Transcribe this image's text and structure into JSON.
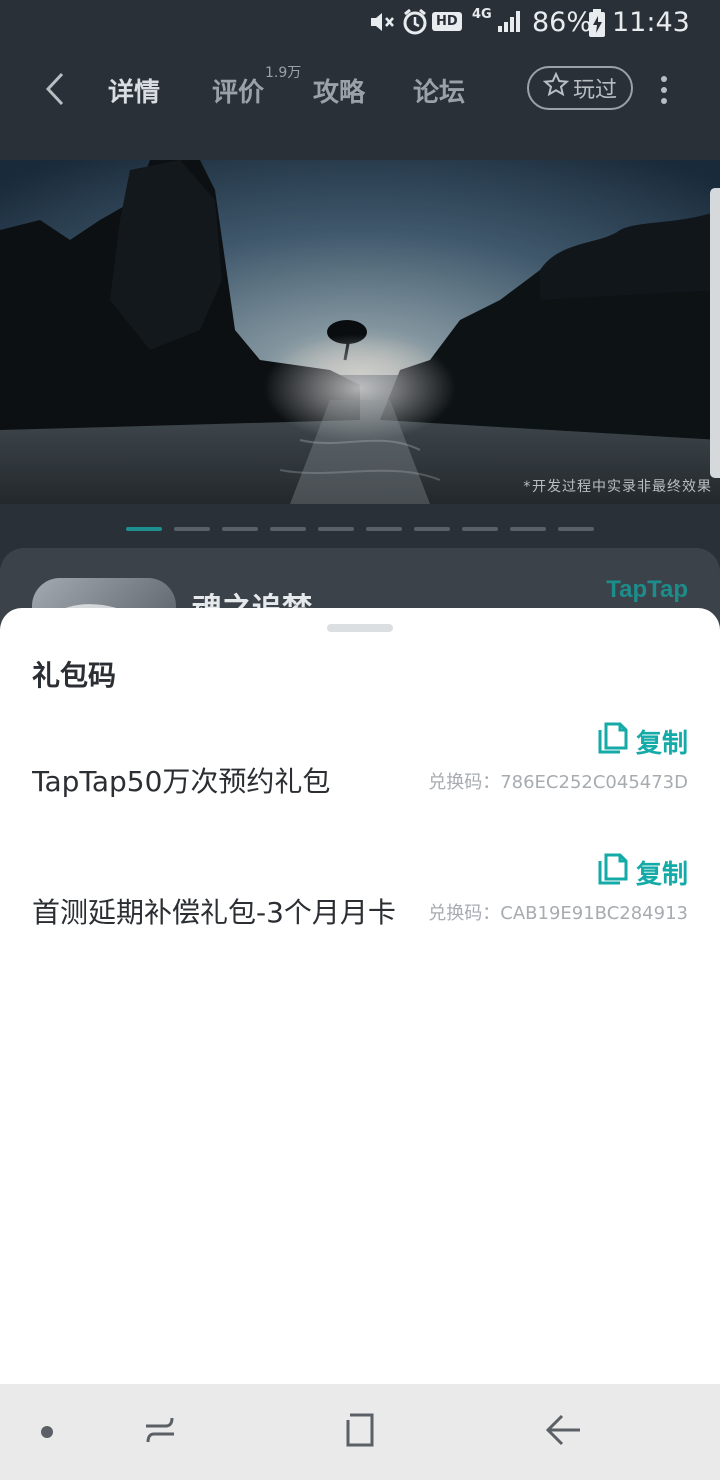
{
  "status_bar": {
    "network": "4G",
    "hd": "HD",
    "battery": "86%",
    "time": "11:43"
  },
  "nav": {
    "tabs": [
      {
        "label": "详情",
        "active": true
      },
      {
        "label": "评价",
        "badge": "1.9万"
      },
      {
        "label": "攻略"
      },
      {
        "label": "论坛"
      }
    ],
    "played_label": "玩过"
  },
  "hero": {
    "caption": "*开发过程中实录非最终效果",
    "page_count": 10,
    "active_page": 0
  },
  "game": {
    "title": "魂之追梦",
    "brand": "TapTap"
  },
  "sheet": {
    "title": "礼包码",
    "gifts": [
      {
        "name": "TapTap50万次预约礼包",
        "copy_label": "复制",
        "code": "兑换码：786EC252C045473D"
      },
      {
        "name": "首测延期补偿礼包-3个月月卡",
        "copy_label": "复制",
        "code": "兑换码：CAB19E91BC284913"
      }
    ]
  },
  "colors": {
    "accent": "#14aaa7",
    "brand": "#1c8d8b",
    "page_bg": "#2a3037"
  },
  "icons": [
    "mute-icon",
    "alarm-icon",
    "signal-icon",
    "battery-icon",
    "back-icon",
    "star-icon",
    "more-icon",
    "copy-icon",
    "recent-apps-icon",
    "home-icon",
    "nav-back-icon"
  ]
}
